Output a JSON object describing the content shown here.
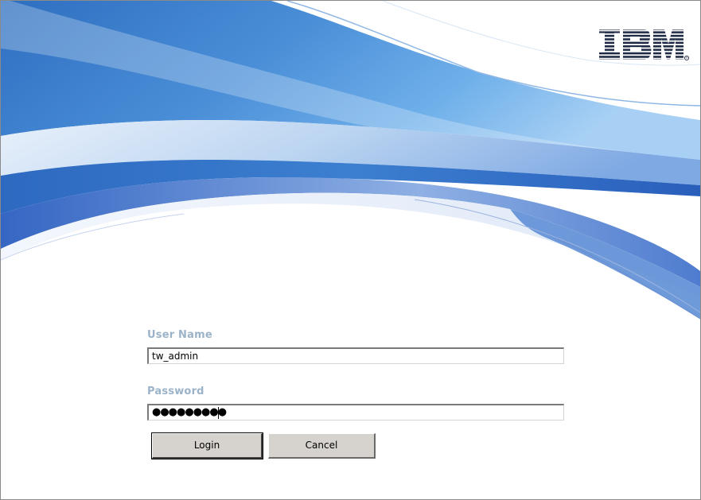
{
  "brand": {
    "logo_text": "IBM",
    "registered_mark": "®",
    "accent_color": "#3d78c6",
    "light_accent_color": "#a9c6ea"
  },
  "login_form": {
    "username_label": "User Name",
    "username_value": "tw_admin",
    "password_label": "Password",
    "password_value": "●●●●●●●●●",
    "login_label": "Login",
    "cancel_label": "Cancel",
    "label_color": "#9bb3c8"
  }
}
